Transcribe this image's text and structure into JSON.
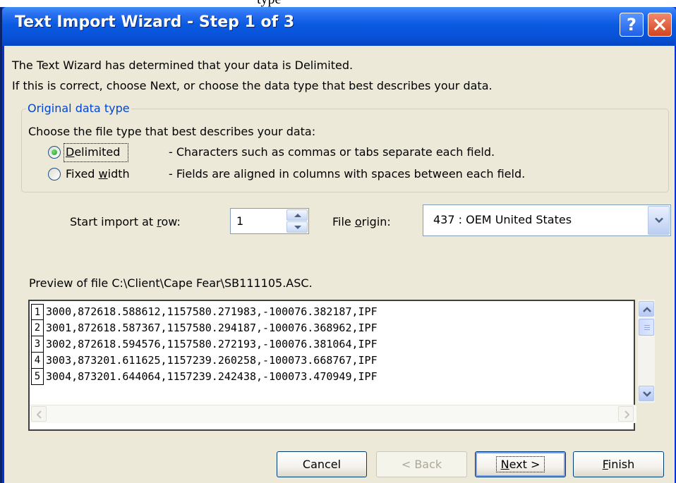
{
  "page_fragment": "type",
  "window": {
    "title": "Text Import Wizard - Step 1 of 3"
  },
  "intro": {
    "line1": "The Text Wizard has determined that your data is Delimited.",
    "line2": "If this is correct, choose Next, or choose the data type that best describes your data."
  },
  "group": {
    "legend": "Original data type",
    "prompt": "Choose the file type that best describes your data:",
    "options": [
      {
        "label_first": "D",
        "label_rest": "elimited",
        "description": "- Characters such as commas or tabs separate each field.",
        "selected": true
      },
      {
        "label_first": "Fixed ",
        "label_underline": "w",
        "label_rest": "idth",
        "description": "- Fields are aligned in columns with spaces between each field.",
        "selected": false
      }
    ]
  },
  "start_row": {
    "label_before": "Start import at ",
    "label_underline": "r",
    "label_after": "ow:",
    "value": "1"
  },
  "file_origin": {
    "label_before": "File ",
    "label_underline": "o",
    "label_after": "rigin:",
    "value": "437 : OEM United States"
  },
  "preview": {
    "label": "Preview of file C:\\Client\\Cape Fear\\SB111105.ASC.",
    "rows": [
      {
        "num": "1",
        "text": "3000,872618.588612,1157580.271983,-100076.382187,IPF"
      },
      {
        "num": "2",
        "text": "3001,872618.587367,1157580.294187,-100076.368962,IPF"
      },
      {
        "num": "3",
        "text": "3002,872618.594576,1157580.272193,-100076.381064,IPF"
      },
      {
        "num": "4",
        "text": "3003,873201.611625,1157239.260258,-100073.668767,IPF"
      },
      {
        "num": "5",
        "text": "3004,873201.644064,1157239.242438,-100073.470949,IPF"
      }
    ]
  },
  "buttons": {
    "cancel": "Cancel",
    "back": "< Back",
    "next_underline": "N",
    "next_rest": "ext >",
    "finish_underline": "F",
    "finish_rest": "inish"
  },
  "colors": {
    "titlebar": "#0a5be1",
    "dialog_bg": "#ece9d8",
    "groupbox_legend": "#0046d5"
  }
}
